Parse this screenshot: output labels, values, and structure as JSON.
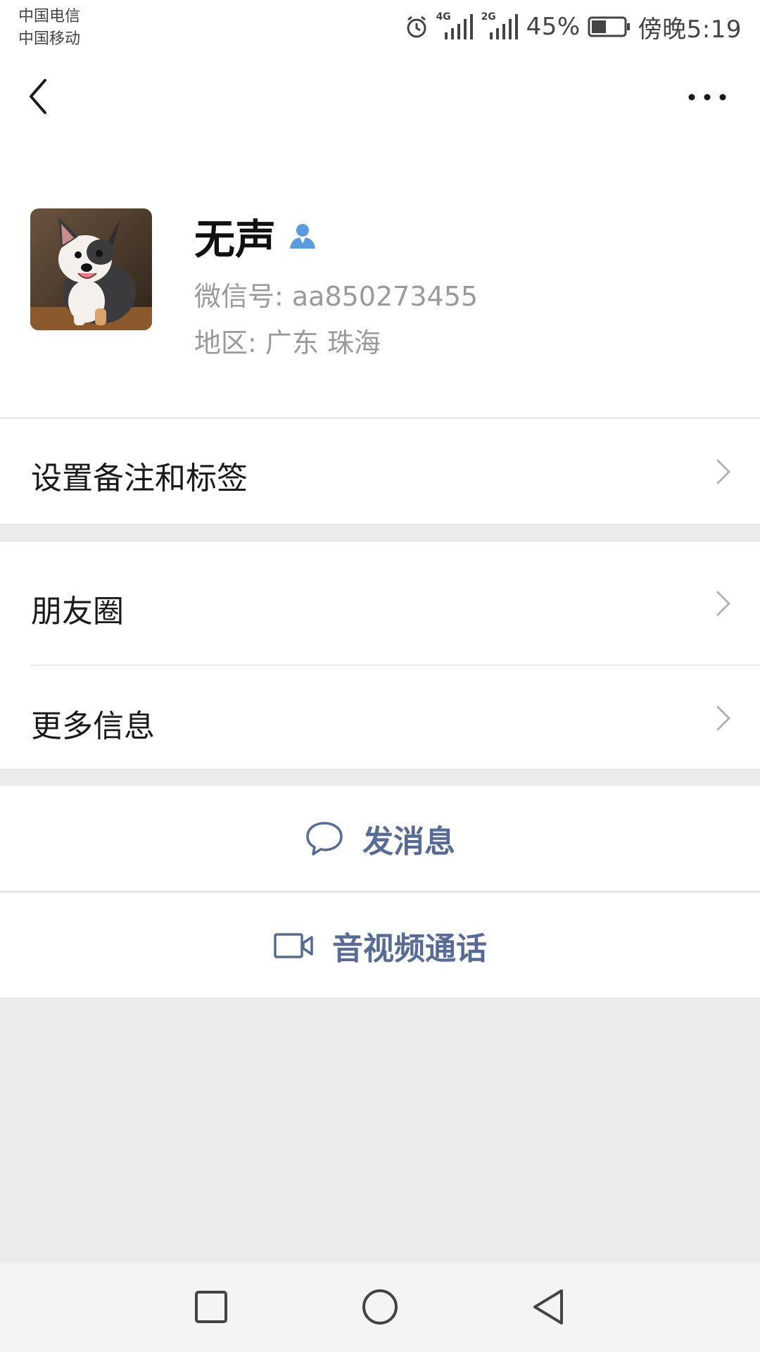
{
  "status_bar": {
    "carrier_1": "中国电信",
    "carrier_2": "中国移动",
    "network_1": "4G",
    "network_2": "2G",
    "battery": "45%",
    "time": "傍晚5:19",
    "icons": [
      "alarm-icon",
      "signal-icon",
      "signal-icon",
      "battery-icon"
    ]
  },
  "header": {
    "back_icon": "chevron-left-icon",
    "more_icon": "more-dots-icon"
  },
  "profile": {
    "name": "无声",
    "wechat_id": "微信号: aa850273455",
    "region": "地区: 广东  珠海",
    "contact_icon": "person-icon"
  },
  "menu": {
    "remark": "设置备注和标签",
    "moments": "朋友圈",
    "more_info": "更多信息"
  },
  "actions": {
    "message": "发消息",
    "call": "音视频通话",
    "accent": "#576b95"
  },
  "navbar": {
    "icons": [
      "recent-apps-icon",
      "home-icon",
      "back-triangle-icon"
    ]
  }
}
